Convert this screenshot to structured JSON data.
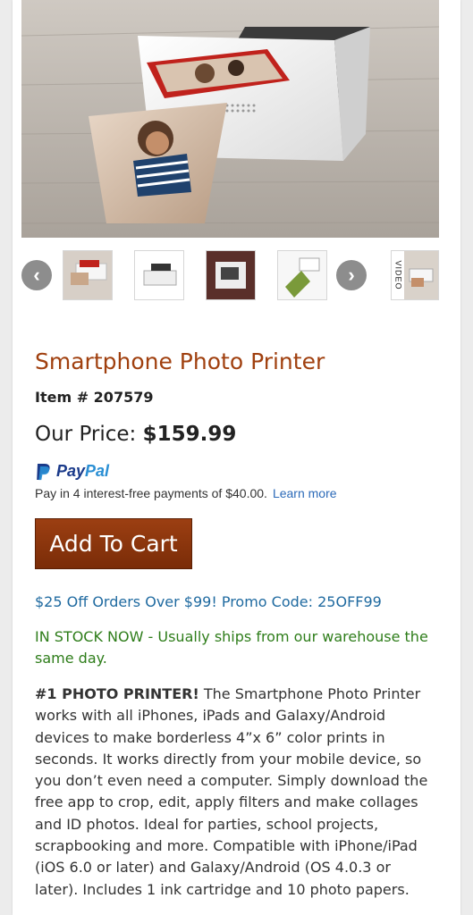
{
  "product": {
    "title": "Smartphone Photo Printer",
    "item_number": "Item # 207579",
    "price_label": "Our Price: ",
    "price": "$159.99"
  },
  "paypal": {
    "brand_pay": "Pay",
    "brand_pal": "Pal",
    "installments_text": "Pay in 4 interest-free payments of $40.00.",
    "learn_more": "Learn more"
  },
  "cart": {
    "button_label": "Add To Cart"
  },
  "promo": "$25 Off Orders Over $99! Promo Code: 25OFF99",
  "stock": "IN STOCK NOW - Usually ships from our warehouse the same day.",
  "description": {
    "lead": "#1 PHOTO PRINTER!",
    "body": " The Smartphone Photo Printer works with all iPhones, iPads and Galaxy/Android devices to make borderless 4”x 6” color prints in seconds. It works directly from your mobile device, so you don’t even need a computer. Simply download the free app to crop, edit, apply filters and make collages and ID photos. Ideal for parties, school projects, scrapbooking and more. Compatible with iPhone/iPad (iOS 6.0 or later) and Galaxy/Android (OS 4.0.3 or later). Includes 1 ink cartridge and 10 photo papers."
  },
  "gallery": {
    "video_label": "VIDEO",
    "prev_icon": "chevron-left-icon",
    "next_icon": "chevron-right-icon"
  },
  "colors": {
    "title": "#a0400f",
    "cart_button": "#8a3510",
    "promo": "#1f6aa0",
    "stock": "#2e7d1a",
    "paypal_dark": "#1a3a8a",
    "paypal_light": "#2a8fd4"
  }
}
